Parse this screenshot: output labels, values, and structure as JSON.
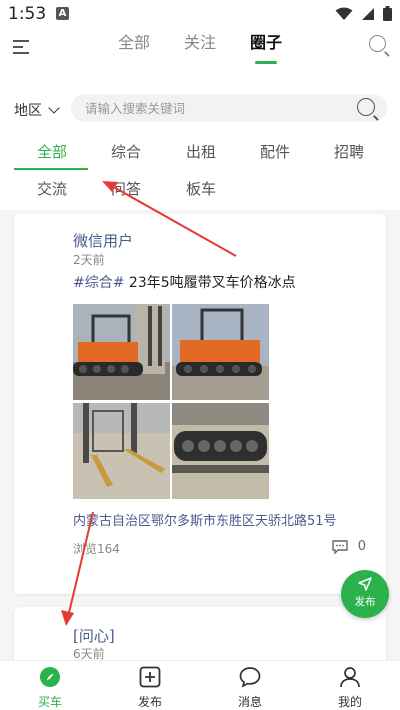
{
  "status_bar": {
    "time": "1:53",
    "notif": "A"
  },
  "top_nav": {
    "tabs": [
      "全部",
      "关注",
      "圈子"
    ],
    "active_tab": "圈子"
  },
  "filter": {
    "region_label": "地区",
    "search_placeholder": "请输入搜索关键词",
    "categories_row1": [
      "全部",
      "综合",
      "出租",
      "配件",
      "招聘"
    ],
    "categories_row2": [
      "交流",
      "问答",
      "板车"
    ],
    "active_category": "全部"
  },
  "posts": [
    {
      "author": "微信用户",
      "time": "2天前",
      "tag": "#综合#",
      "title": "23年5吨履带叉车价格冰点",
      "location": "内蒙古自治区鄂尔多斯市东胜区天骄北路51号",
      "views": "浏览164",
      "comments": "0"
    },
    {
      "author": "[问心]",
      "time": "6天前"
    }
  ],
  "fab": {
    "label": "发布"
  },
  "bottom_nav": {
    "items": [
      "买车",
      "发布",
      "消息",
      "我的"
    ],
    "active": "买车"
  },
  "colors": {
    "accent": "#2bb24c",
    "link": "#4a5a8c",
    "annotation_arrow": "#e53935"
  }
}
